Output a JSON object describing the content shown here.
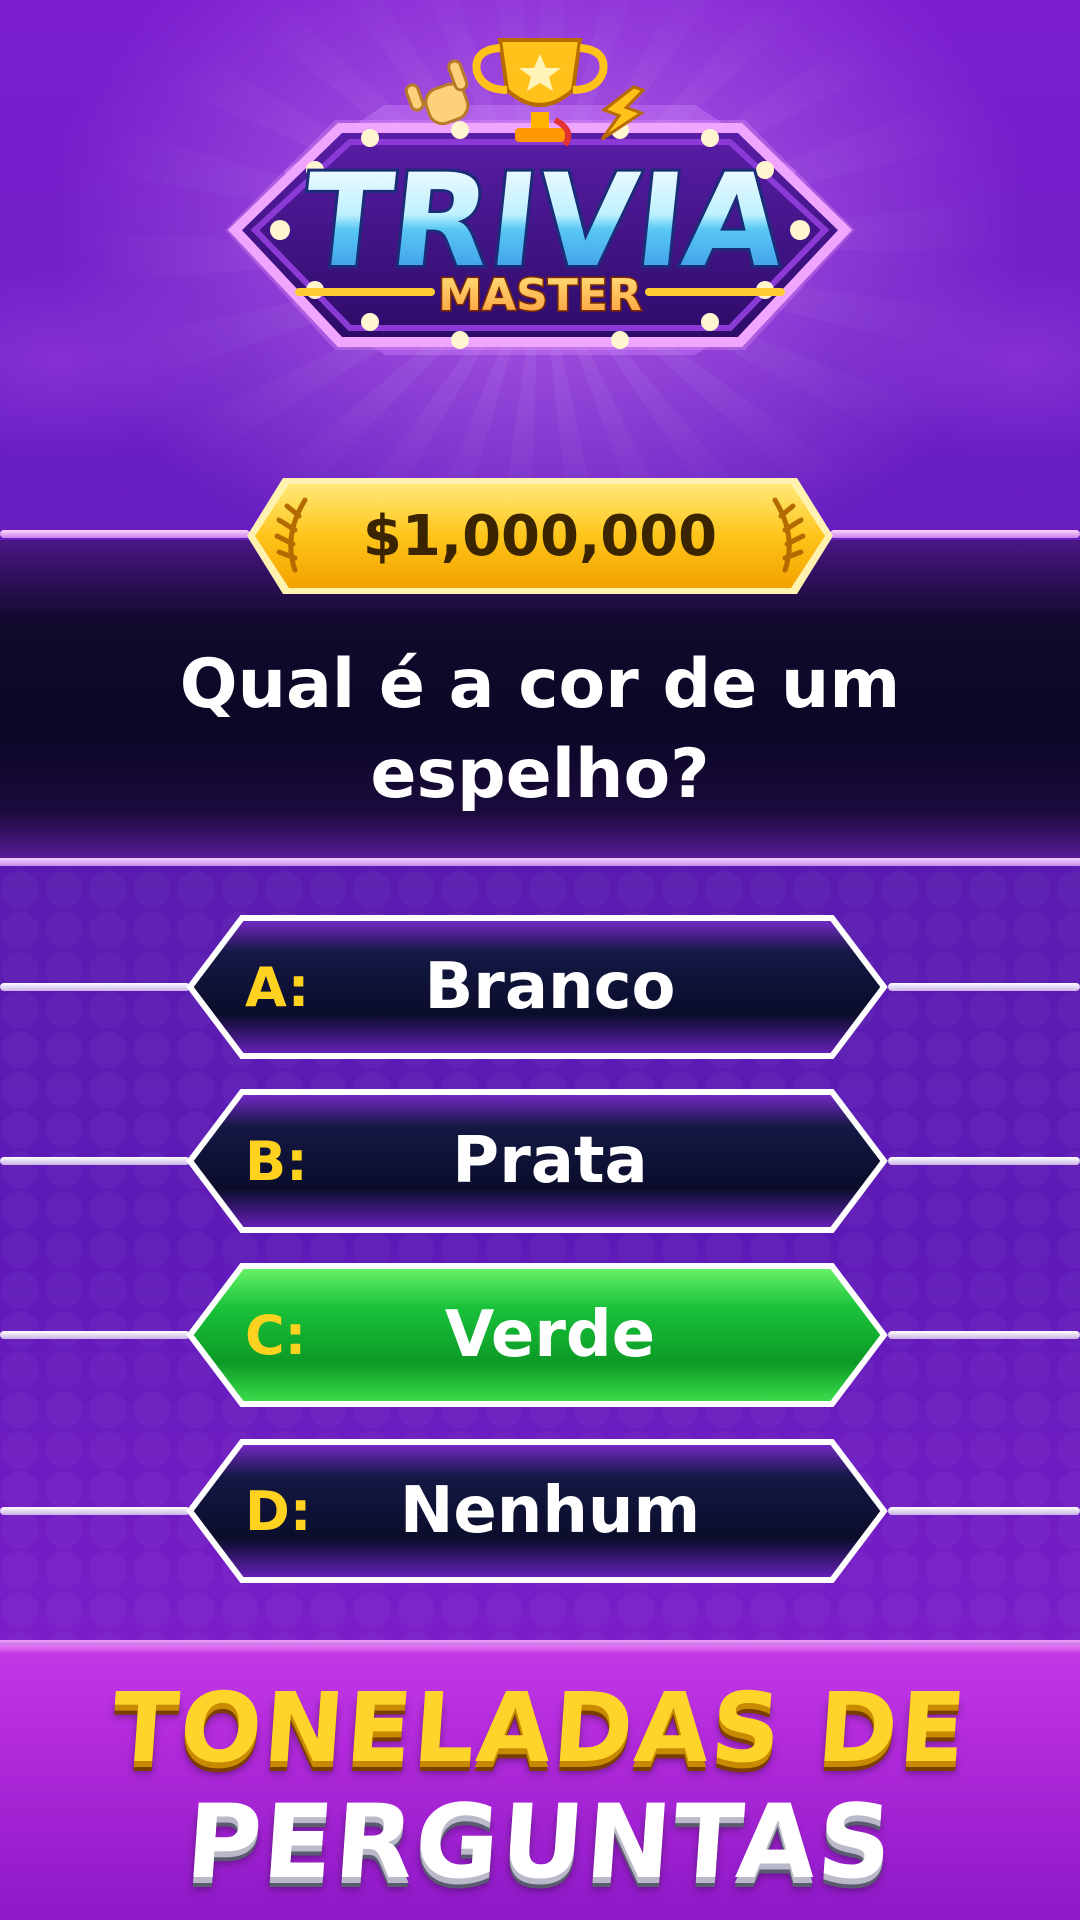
{
  "logo": {
    "title": "TRIVIA",
    "subtitle": "MASTER"
  },
  "prize": {
    "amount": "$1,000,000"
  },
  "question": {
    "text": "Qual é a cor de um espelho?"
  },
  "answers": [
    {
      "letter": "A:",
      "label": "Branco",
      "state": "default"
    },
    {
      "letter": "B:",
      "label": "Prata",
      "state": "default"
    },
    {
      "letter": "C:",
      "label": "Verde",
      "state": "selected"
    },
    {
      "letter": "D:",
      "label": "Nenhum",
      "state": "default"
    }
  ],
  "banner": {
    "line1": "TONELADAS DE",
    "line2": "PERGUNTAS"
  },
  "colors": {
    "background": "#6a1fc4",
    "answer_default": "#0d1030",
    "answer_selected": "#19c23a",
    "answer_letter": "#ffd21f",
    "prize_gold": "#ffc51a"
  }
}
